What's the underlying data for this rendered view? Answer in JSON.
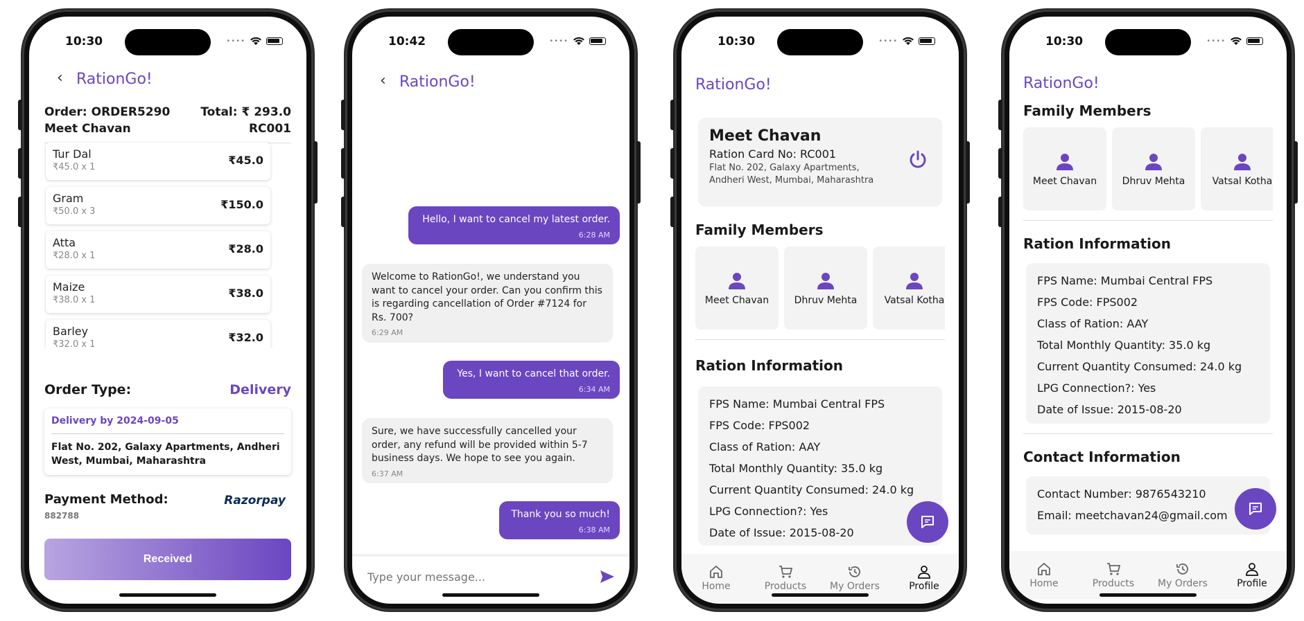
{
  "brand_color": "#6b46c1",
  "app_title": "RationGo!",
  "p1": {
    "time": "10:30",
    "order_label": "Order: ORDER5290",
    "total_label": "Total: ₹ 293.0",
    "customer": "Meet Chavan",
    "ration_card": "RC001",
    "items": [
      {
        "name": "Tur Dal",
        "qty": "₹45.0 x 1",
        "price": "₹45.0"
      },
      {
        "name": "Gram",
        "qty": "₹50.0 x 3",
        "price": "₹150.0"
      },
      {
        "name": "Atta",
        "qty": "₹28.0 x 1",
        "price": "₹28.0"
      },
      {
        "name": "Maize",
        "qty": "₹38.0 x 1",
        "price": "₹38.0"
      },
      {
        "name": "Barley",
        "qty": "₹32.0 x 1",
        "price": "₹32.0"
      }
    ],
    "order_type_label": "Order Type:",
    "order_type_value": "Delivery",
    "delivery_date": "Delivery by 2024-09-05",
    "delivery_address": "Flat No. 202, Galaxy Apartments, Andheri West, Mumbai, Maharashtra",
    "payment_label": "Payment Method:",
    "payment_id": "882788",
    "payment_provider": "Razorpay",
    "status_button": "Received"
  },
  "p2": {
    "time": "10:42",
    "messages": [
      {
        "from": "me",
        "text": "Hello, I want to cancel my latest order.",
        "time": "6:28 AM"
      },
      {
        "from": "bot",
        "text": "Welcome to RationGo!, we understand you want to cancel your order. Can you confirm this is regarding cancellation of Order #7124 for Rs. 700?",
        "time": "6:29 AM"
      },
      {
        "from": "me",
        "text": "Yes, I want to cancel that order.",
        "time": "6:34 AM"
      },
      {
        "from": "bot",
        "text": "Sure, we have successfully cancelled your order, any refund will be provided within 5-7 business days. We hope to see you again.",
        "time": "6:37 AM"
      },
      {
        "from": "me",
        "text": "Thank you so much!",
        "time": "6:38 AM"
      }
    ],
    "input_placeholder": "Type your message..."
  },
  "p3": {
    "time": "10:30",
    "user_name": "Meet Chavan",
    "ration_card": "Ration Card No: RC001",
    "address": "Flat No. 202, Galaxy Apartments, Andheri West, Mumbai, Maharashtra",
    "family_title": "Family Members",
    "family": [
      "Meet Chavan",
      "Dhruv Mehta",
      "Vatsal Kotha"
    ],
    "ration_title": "Ration Information",
    "ration_info": [
      "FPS Name: Mumbai Central FPS",
      "FPS Code: FPS002",
      "Class of Ration: AAY",
      "Total Monthly Quantity: 35.0 kg",
      "Current Quantity Consumed: 24.0 kg",
      "LPG Connection?: Yes",
      "Date of Issue: 2015-08-20"
    ]
  },
  "p4": {
    "time": "10:30",
    "family_title": "Family Members",
    "family": [
      "Meet Chavan",
      "Dhruv Mehta",
      "Vatsal Kotha"
    ],
    "ration_title": "Ration Information",
    "ration_info": [
      "FPS Name: Mumbai Central FPS",
      "FPS Code: FPS002",
      "Class of Ration: AAY",
      "Total Monthly Quantity: 35.0 kg",
      "Current Quantity Consumed: 24.0 kg",
      "LPG Connection?: Yes",
      "Date of Issue: 2015-08-20"
    ],
    "contact_title": "Contact Information",
    "contact_info": [
      "Contact Number: 9876543210",
      "Email: meetchavan24@gmail.com"
    ]
  },
  "tabs": [
    {
      "label": "Home",
      "icon": "home-icon"
    },
    {
      "label": "Products",
      "icon": "cart-icon"
    },
    {
      "label": "My Orders",
      "icon": "history-icon"
    },
    {
      "label": "Profile",
      "icon": "profile-icon"
    }
  ]
}
